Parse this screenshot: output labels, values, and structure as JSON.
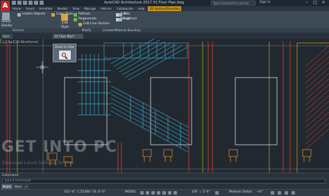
{
  "app": {
    "title": "AutoCAD Architecture 2017   01 Floor Plan.dwg",
    "search_placeholder": "Type a keyword or phrase",
    "sign_in": "Sign In"
  },
  "ribbon_tabs": [
    "Home",
    "Insert",
    "Annotate",
    "Render",
    "View",
    "Manage",
    "Add-ins",
    "Collaborate",
    "Help",
    "2D Section/Elevation"
  ],
  "active_tab_index": 9,
  "ribbon": {
    "select": "Select",
    "similar": "Similar",
    "isolate_objects": "Isolate Objects",
    "copy_style": "Copy Style",
    "edit": "Edit",
    "style": "Style",
    "refresh": "Refresh",
    "regenerate": "Regenerate",
    "edit_line_section": "Edit Line Section",
    "edit_2": "Edit",
    "merge": "Merge",
    "add": "Add",
    "subtract": "Subtract"
  },
  "panels": [
    "General",
    "Modify",
    "Linework",
    "Material Boundary"
  ],
  "doc_tabs": {
    "start": "Start",
    "current": "01 Floor Plan*"
  },
  "canvas": {
    "view_label": "[-][Top][2D Wireframe]",
    "zoom_popup_title": "Zoom to View"
  },
  "watermark": {
    "main": "GET INTO PC",
    "sub": "Download Latest Software for Free"
  },
  "command": {
    "history": "Command:",
    "placeholder": "Type a command"
  },
  "layout_tabs": [
    "Model",
    "Work",
    "+"
  ],
  "status": {
    "coords": "312'-4\", 1,25384'-10, 0'-0\"",
    "mode": "MODEL",
    "scale": "1/8\" = 1'-0\"",
    "detail": "Medium Detail",
    "elevation": "+0\""
  },
  "colors": {
    "stair_cyan": "#3aa8c8",
    "wall_red": "#c0392b",
    "door_yellow": "#d7b400",
    "furniture_orange": "#d88c2a",
    "accent_tab": "#c4941d",
    "brand_red": "#c0251f"
  }
}
